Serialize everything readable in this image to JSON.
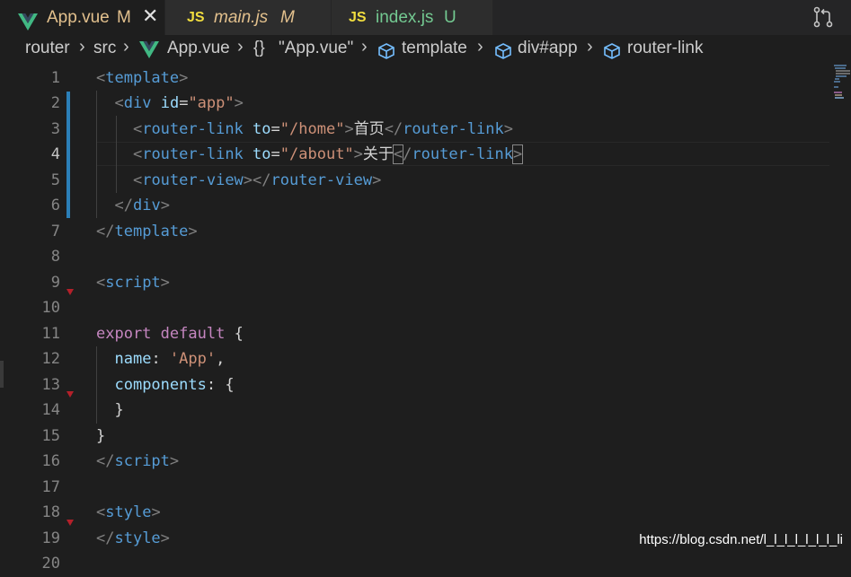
{
  "tabs": [
    {
      "icon": "vue-icon",
      "name": "App.vue",
      "status": "M",
      "name_color": "#e2c08d",
      "status_color": "#e2c08d",
      "active": true,
      "italic": false
    },
    {
      "icon": "js-icon",
      "badge": "JS",
      "name": "main.js",
      "status": "M",
      "name_color": "#e2c08d",
      "status_color": "#e2c08d",
      "active": false,
      "italic": true
    },
    {
      "icon": "js-icon",
      "badge": "JS",
      "name": "index.js",
      "status": "U",
      "name_color": "#73c991",
      "status_color": "#73c991",
      "active": false,
      "italic": false
    }
  ],
  "close_label": "✕",
  "breadcrumb": {
    "router": "router",
    "src": "src",
    "file": "App.vue",
    "braces": "{}",
    "module": "\"App.vue\"",
    "template": "template",
    "div": "div#app",
    "link": "router-link"
  },
  "gutter": [
    "1",
    "2",
    "3",
    "4",
    "5",
    "6",
    "7",
    "8",
    "9",
    "10",
    "11",
    "12",
    "13",
    "14",
    "15",
    "16",
    "17",
    "18",
    "19",
    "20"
  ],
  "code": [
    [
      [
        "punc",
        "<"
      ],
      [
        "tag",
        "template"
      ],
      [
        "punc",
        ">"
      ]
    ],
    [
      [
        "text",
        "  "
      ],
      [
        "punc",
        "<"
      ],
      [
        "tag",
        "div"
      ],
      [
        "text",
        " "
      ],
      [
        "attr",
        "id"
      ],
      [
        "op",
        "="
      ],
      [
        "str",
        "\"app\""
      ],
      [
        "punc",
        ">"
      ]
    ],
    [
      [
        "text",
        "    "
      ],
      [
        "punc",
        "<"
      ],
      [
        "tag",
        "router-link"
      ],
      [
        "text",
        " "
      ],
      [
        "attr",
        "to"
      ],
      [
        "op",
        "="
      ],
      [
        "str",
        "\"/home\""
      ],
      [
        "punc",
        ">"
      ],
      [
        "text",
        "首页"
      ],
      [
        "punc",
        "</"
      ],
      [
        "tag",
        "router-link"
      ],
      [
        "punc",
        ">"
      ]
    ],
    [
      [
        "text",
        "    "
      ],
      [
        "punc",
        "<"
      ],
      [
        "tag",
        "router-link"
      ],
      [
        "text",
        " "
      ],
      [
        "attr",
        "to"
      ],
      [
        "op",
        "="
      ],
      [
        "str",
        "\"/about\""
      ],
      [
        "punc",
        ">"
      ],
      [
        "text",
        "关于"
      ],
      [
        "bpunc",
        "<"
      ],
      [
        "punc",
        "/"
      ],
      [
        "tag",
        "router-link"
      ],
      [
        "bpunc",
        ">"
      ]
    ],
    [
      [
        "text",
        "    "
      ],
      [
        "punc",
        "<"
      ],
      [
        "tag",
        "router-view"
      ],
      [
        "punc",
        "></"
      ],
      [
        "tag",
        "router-view"
      ],
      [
        "punc",
        ">"
      ]
    ],
    [
      [
        "text",
        "  "
      ],
      [
        "punc",
        "</"
      ],
      [
        "tag",
        "div"
      ],
      [
        "punc",
        ">"
      ]
    ],
    [
      [
        "punc",
        "</"
      ],
      [
        "tag",
        "template"
      ],
      [
        "punc",
        ">"
      ]
    ],
    [],
    [
      [
        "punc",
        "<"
      ],
      [
        "tag",
        "script"
      ],
      [
        "punc",
        ">"
      ]
    ],
    [],
    [
      [
        "kw",
        "export"
      ],
      [
        "text",
        " "
      ],
      [
        "kw",
        "default"
      ],
      [
        "text",
        " {"
      ]
    ],
    [
      [
        "text",
        "  "
      ],
      [
        "prop",
        "name"
      ],
      [
        "text",
        ": "
      ],
      [
        "str",
        "'App'"
      ],
      [
        "text",
        ","
      ]
    ],
    [
      [
        "text",
        "  "
      ],
      [
        "prop",
        "components"
      ],
      [
        "text",
        ": {"
      ]
    ],
    [
      [
        "text",
        "  }"
      ]
    ],
    [
      [
        "text",
        "}"
      ]
    ],
    [
      [
        "punc",
        "</"
      ],
      [
        "tag",
        "script"
      ],
      [
        "punc",
        ">"
      ]
    ],
    [],
    [
      [
        "punc",
        "<"
      ],
      [
        "tag",
        "style"
      ],
      [
        "punc",
        ">"
      ]
    ],
    [
      [
        "punc",
        "</"
      ],
      [
        "tag",
        "style"
      ],
      [
        "punc",
        ">"
      ]
    ],
    []
  ],
  "watermark": "https://blog.csdn.net/l_l_l_l_l_l_l_li"
}
